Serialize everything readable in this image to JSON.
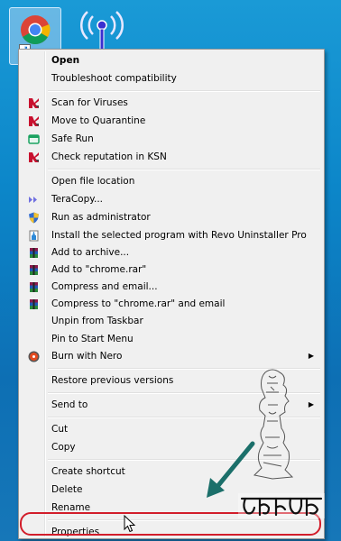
{
  "desktop": {
    "icons": [
      {
        "name": "chrome-shortcut",
        "icon": "chrome-logo"
      },
      {
        "name": "wifi",
        "icon": "wifi-icon"
      }
    ]
  },
  "menu": {
    "open": "Open",
    "troubleshoot": "Troubleshoot compatibility",
    "scan": "Scan for Viruses",
    "quarantine": "Move to Quarantine",
    "safe_run": "Safe Run",
    "check_rep": "Check reputation in KSN",
    "open_location": "Open file location",
    "teracopy": "TeraCopy...",
    "run_admin": "Run as administrator",
    "revo": "Install the selected program with Revo Uninstaller Pro",
    "add_archive": "Add to archive...",
    "add_rar": "Add to \"chrome.rar\"",
    "compress_email": "Compress and email...",
    "compress_rar_email": "Compress to \"chrome.rar\" and email",
    "unpin_taskbar": "Unpin from Taskbar",
    "pin_start": "Pin to Start Menu",
    "burn_nero": "Burn with Nero",
    "restore": "Restore previous versions",
    "send_to": "Send to",
    "cut": "Cut",
    "copy": "Copy",
    "create_shortcut": "Create shortcut",
    "delete": "Delete",
    "rename": "Rename",
    "properties": "Properties"
  },
  "colors": {
    "highlight_ring": "#d21d2a",
    "kaspersky": "#c8102e",
    "arrow": "#1b6f6a"
  }
}
